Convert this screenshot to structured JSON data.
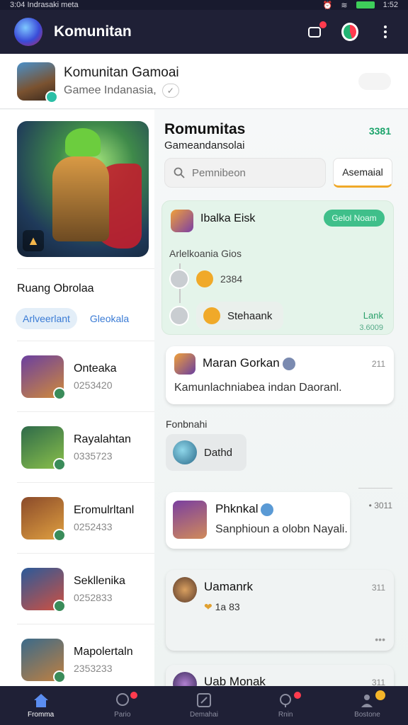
{
  "status_bar": {
    "left": "3:04 Indrasaki meta",
    "right": "1:52"
  },
  "app_bar": {
    "title": "Komunitan"
  },
  "group": {
    "name": "Komunitan Gamoai",
    "subtitle": "Gamee Indanasia,"
  },
  "left": {
    "room_title": "Ruang Obrolaa",
    "chips": [
      "Arlveerlant",
      "Gleokala"
    ],
    "members": [
      {
        "name": "Onteaka",
        "id": "0253420",
        "colors": [
          "#6a3fa0",
          "#d08a3a"
        ]
      },
      {
        "name": "Rayalahtan",
        "id": "0335723",
        "colors": [
          "#2e6a4a",
          "#8ac04a"
        ]
      },
      {
        "name": "Eromulrltanl",
        "id": "0252433",
        "colors": [
          "#8a4a2a",
          "#e0a040"
        ]
      },
      {
        "name": "Sekllenika",
        "id": "0252833",
        "colors": [
          "#2a5a9a",
          "#d05040"
        ]
      },
      {
        "name": "Mapolertaln",
        "id": "2353233",
        "colors": [
          "#3a6a8a",
          "#c08040"
        ]
      }
    ]
  },
  "right": {
    "title": "Romumitas",
    "count": "3381",
    "subtitle": "Gameandansolai",
    "search": {
      "placeholder": "Pemnibeon"
    },
    "send_label": "Asemaial",
    "featured": {
      "title": "Ibalka Eisk",
      "join_label": "Gelol Noam",
      "label": "Arlelkoania Gios",
      "thread_num": "2384",
      "thread_name": "Stehaank",
      "stat": "Lank",
      "stat_sub": "3.6009"
    },
    "cards": [
      {
        "name": "Maran Gorkan",
        "body": "Kamunlachniabea indan Daoranl.",
        "time": "211"
      },
      {
        "name": "Phknkal",
        "body": "Sanphioun a olobn Nayali.",
        "time": ""
      },
      {
        "name": "Uamanrk",
        "body": "1a 83",
        "time": "311"
      },
      {
        "name": "Uab Monak",
        "body": "",
        "time": "311"
      }
    ],
    "section_label": "Fonbnahi",
    "mini_chat": "Dathd",
    "side_meta": "• 3011"
  },
  "bottom_nav": [
    "Fromma",
    "Pario",
    "Demahai",
    "Rnin",
    "Bostone"
  ]
}
